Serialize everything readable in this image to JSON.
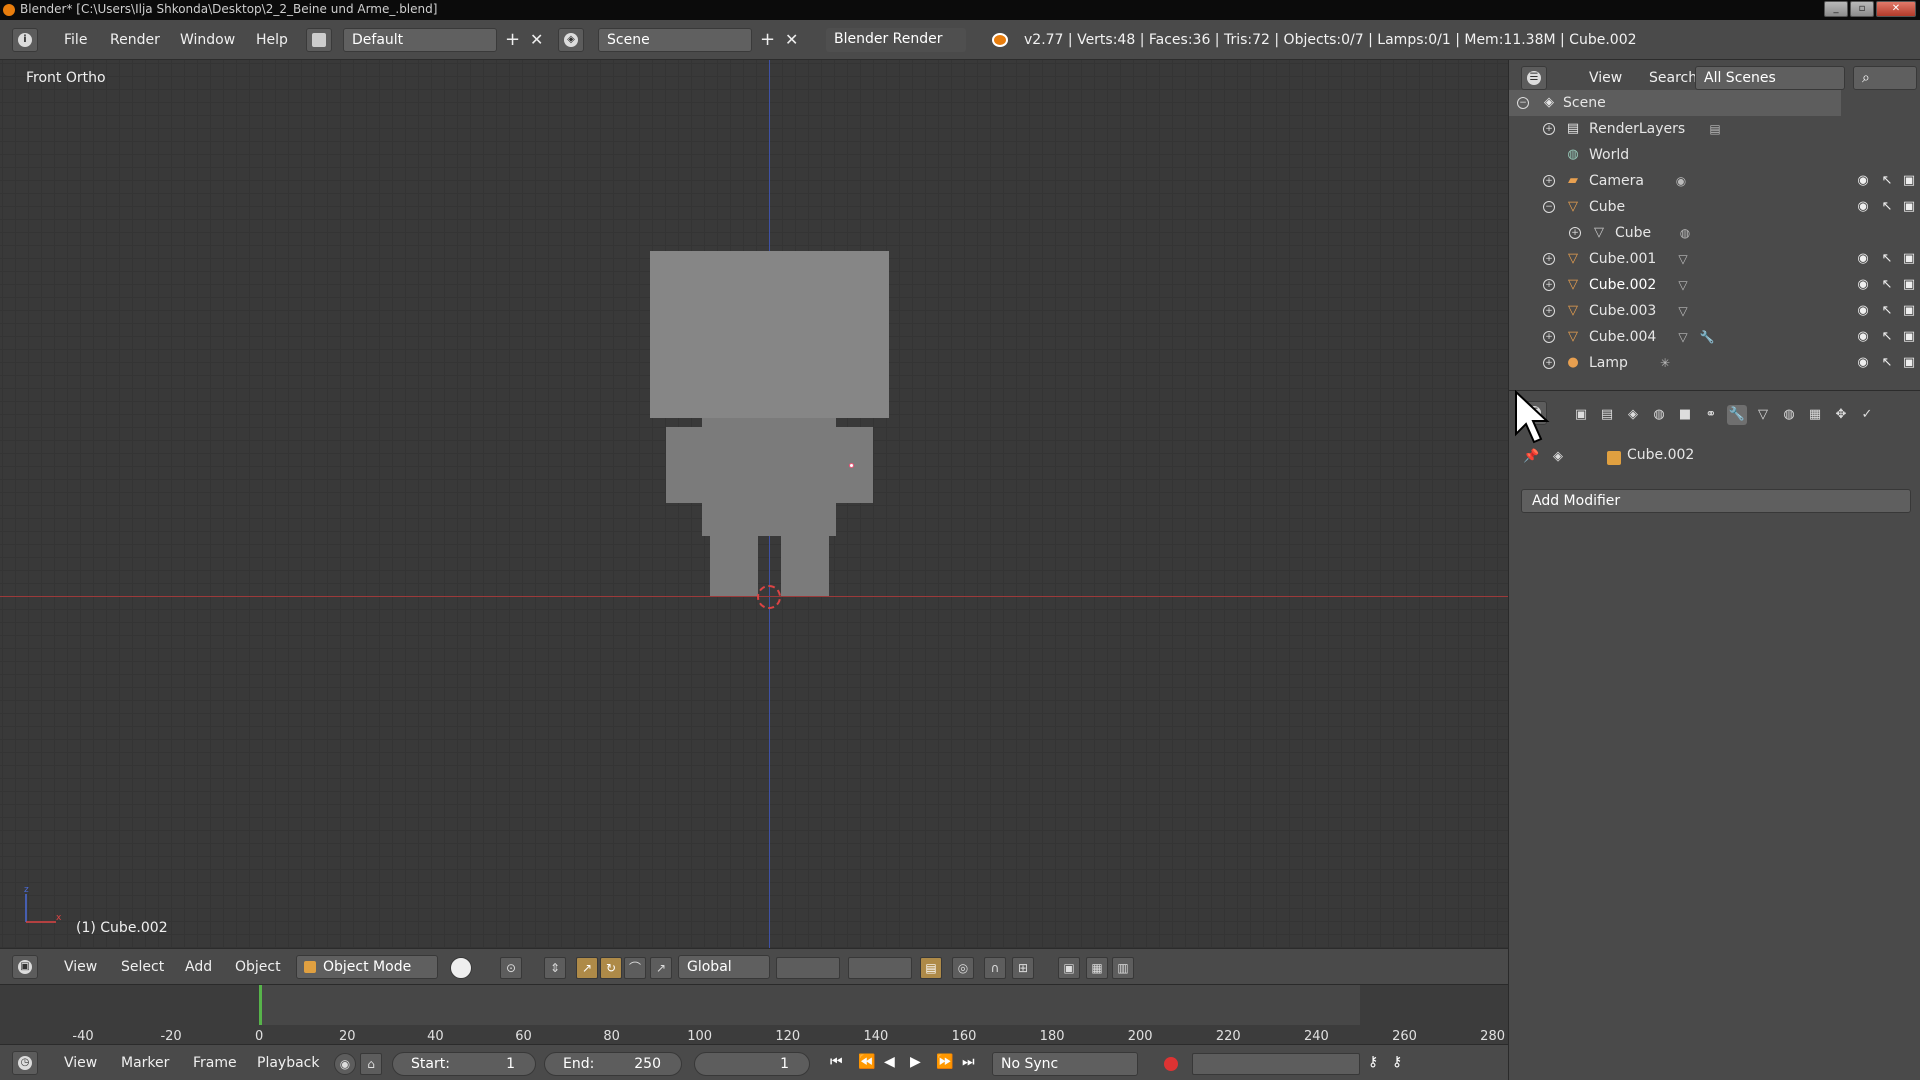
{
  "window": {
    "title": "Blender* [C:\\Users\\Ilja Shkonda\\Desktop\\2_2_Beine und Arme_.blend]"
  },
  "info_header": {
    "menu": [
      "File",
      "Render",
      "Window",
      "Help"
    ],
    "screen_layout": "Default",
    "scene": "Scene",
    "render_engine": "Blender Render",
    "stats": "v2.77 | Verts:48 | Faces:36 | Tris:72 | Objects:0/7 | Lamps:0/1 | Mem:11.38M | Cube.002"
  },
  "viewport": {
    "view_label": "Front Ortho",
    "selected_label": "(1) Cube.002",
    "colors": {
      "background": "#393939",
      "mesh": "#7b7b7b",
      "z_axis": "#3f52a6",
      "x_axis": "#9c3a3a"
    }
  },
  "viewport_header": {
    "menu": [
      "View",
      "Select",
      "Add",
      "Object"
    ],
    "mode": "Object Mode",
    "orientation": "Global"
  },
  "timeline": {
    "ticks": [
      "-40",
      "-20",
      "0",
      "20",
      "40",
      "60",
      "80",
      "100",
      "120",
      "140",
      "160",
      "180",
      "200",
      "220",
      "240",
      "260",
      "280"
    ],
    "menu": [
      "View",
      "Marker",
      "Frame",
      "Playback"
    ],
    "start_label": "Start:",
    "start_value": "1",
    "end_label": "End:",
    "end_value": "250",
    "current_frame": "1",
    "sync": "No Sync"
  },
  "outliner": {
    "menu": [
      "View",
      "Search"
    ],
    "filter": "All Scenes",
    "items": [
      {
        "name": "Scene",
        "icon": "scene-icon"
      },
      {
        "name": "RenderLayers",
        "icon": "render-layers-icon"
      },
      {
        "name": "World",
        "icon": "world-icon"
      },
      {
        "name": "Camera",
        "icon": "camera-icon"
      },
      {
        "name": "Cube",
        "icon": "mesh-object-icon"
      },
      {
        "name": "Cube",
        "icon": "mesh-data-icon"
      },
      {
        "name": "Cube.001",
        "icon": "mesh-object-icon"
      },
      {
        "name": "Cube.002",
        "icon": "mesh-object-icon"
      },
      {
        "name": "Cube.003",
        "icon": "mesh-object-icon"
      },
      {
        "name": "Cube.004",
        "icon": "mesh-object-icon"
      },
      {
        "name": "Lamp",
        "icon": "lamp-icon"
      }
    ]
  },
  "properties": {
    "active_object": "Cube.002",
    "active_tab": "modifiers",
    "add_modifier_label": "Add Modifier"
  }
}
